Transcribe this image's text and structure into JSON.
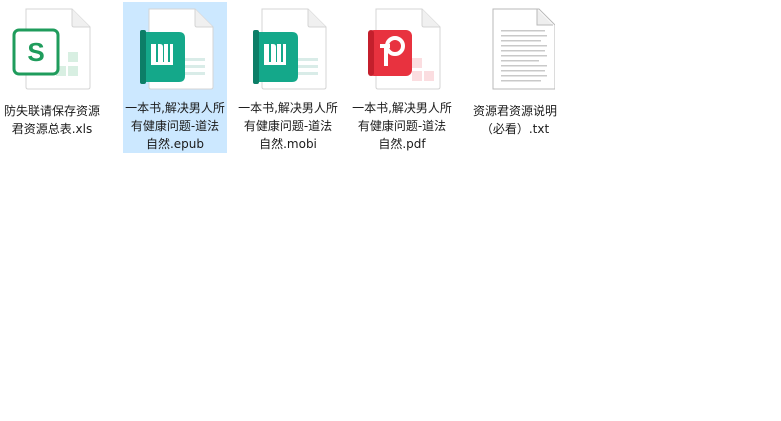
{
  "files": [
    {
      "name": "防失联请保存资源君资源总表.xls",
      "type": "xls",
      "badge_letter": "S",
      "color": "#1f9c5c",
      "icon": "spreadsheet-icon",
      "selected": false
    },
    {
      "name": "一本书,解决男人所有健康问题-道法自然.epub",
      "type": "epub",
      "color": "#14a88a",
      "icon": "book-icon",
      "selected": true
    },
    {
      "name": "一本书,解决男人所有健康问题-道法自然.mobi",
      "type": "mobi",
      "color": "#14a88a",
      "icon": "book-icon",
      "selected": false
    },
    {
      "name": "一本书,解决男人所有健康问题-道法自然.pdf",
      "type": "pdf",
      "color": "#e8323f",
      "icon": "pdf-icon",
      "selected": false
    },
    {
      "name": "资源君资源说明（必看）.txt",
      "type": "txt",
      "color": "#c8c8c8",
      "icon": "text-document-icon",
      "selected": false
    }
  ]
}
